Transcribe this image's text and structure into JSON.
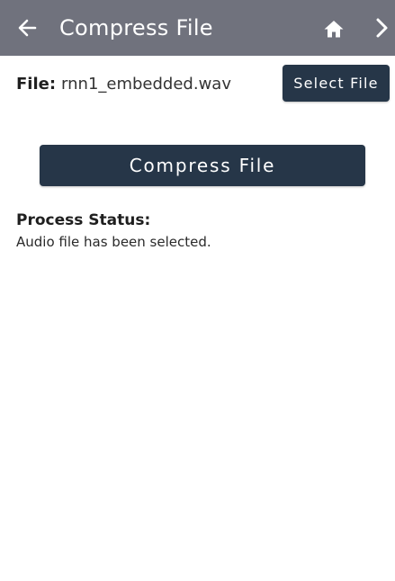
{
  "app_bar": {
    "title": "Compress File",
    "background": "#70727d",
    "icons": {
      "back": "arrow-left",
      "home": "home",
      "next": "chevron-right"
    }
  },
  "file": {
    "label": "File:",
    "name": "rnn1_embedded.wav"
  },
  "buttons": {
    "select_file": "Select File",
    "compress_file": "Compress File",
    "color": "#263648"
  },
  "status": {
    "label": "Process Status:",
    "text": "Audio file has been selected."
  }
}
